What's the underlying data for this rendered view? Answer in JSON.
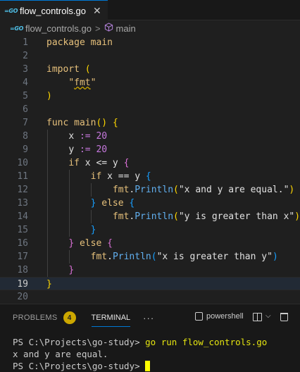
{
  "tab": {
    "icon": "go-icon",
    "label": "flow_controls.go",
    "close": "✕"
  },
  "breadcrumb": {
    "file": "flow_controls.go",
    "symbol": "main",
    "sep": ">"
  },
  "editor": {
    "current_line": 19,
    "lines": [
      "1",
      "2",
      "3",
      "4",
      "5",
      "6",
      "7",
      "8",
      "9",
      "10",
      "11",
      "12",
      "13",
      "14",
      "15",
      "16",
      "17",
      "18",
      "19",
      "20"
    ],
    "code": {
      "l1_kw": "package",
      "l1_name": "main",
      "l3_kw": "import",
      "l3_paren": "(",
      "l4_q1": "\"",
      "l4_str": "fmt",
      "l4_q2": "\"",
      "l5_paren": ")",
      "l7_kw": "func",
      "l7_name": "main",
      "l7_parens": "()",
      "l7_brace": "{",
      "l8_var": "x",
      "l8_op": ":=",
      "l8_num": "20",
      "l9_var": "y",
      "l9_op": ":=",
      "l9_num": "20",
      "l10_kw": "if",
      "l10_cond": "x <= y",
      "l10_brace": "{",
      "l11_kw": "if",
      "l11_cond": "x == y",
      "l11_brace": "{",
      "l12_pkg": "fmt",
      "l12_dot": ".",
      "l12_fn": "Println",
      "l12_p1": "(",
      "l12_str": "\"x and y are equal.\"",
      "l12_p2": ")",
      "l13_brace1": "}",
      "l13_kw": "else",
      "l13_brace2": "{",
      "l14_pkg": "fmt",
      "l14_dot": ".",
      "l14_fn": "Println",
      "l14_p1": "(",
      "l14_str": "\"y is greater than x\"",
      "l14_p2": ")",
      "l15_brace": "}",
      "l16_brace1": "}",
      "l16_kw": "else",
      "l16_brace2": "{",
      "l17_pkg": "fmt",
      "l17_dot": ".",
      "l17_fn": "Println",
      "l17_p1": "(",
      "l17_str": "\"x is greater than y\"",
      "l17_p2": ")",
      "l18_brace": "}",
      "l19_brace": "}"
    }
  },
  "panel": {
    "problems_label": "PROBLEMS",
    "problems_count": "4",
    "terminal_label": "TERMINAL",
    "more": "···",
    "shell": "powershell",
    "chevron": "⌵"
  },
  "terminal": {
    "prompt1": "PS C:\\Projects\\go-study> ",
    "cmd1": "go run flow_controls.go",
    "out1": "x and y are equal.",
    "prompt2": "PS C:\\Projects\\go-study> "
  }
}
